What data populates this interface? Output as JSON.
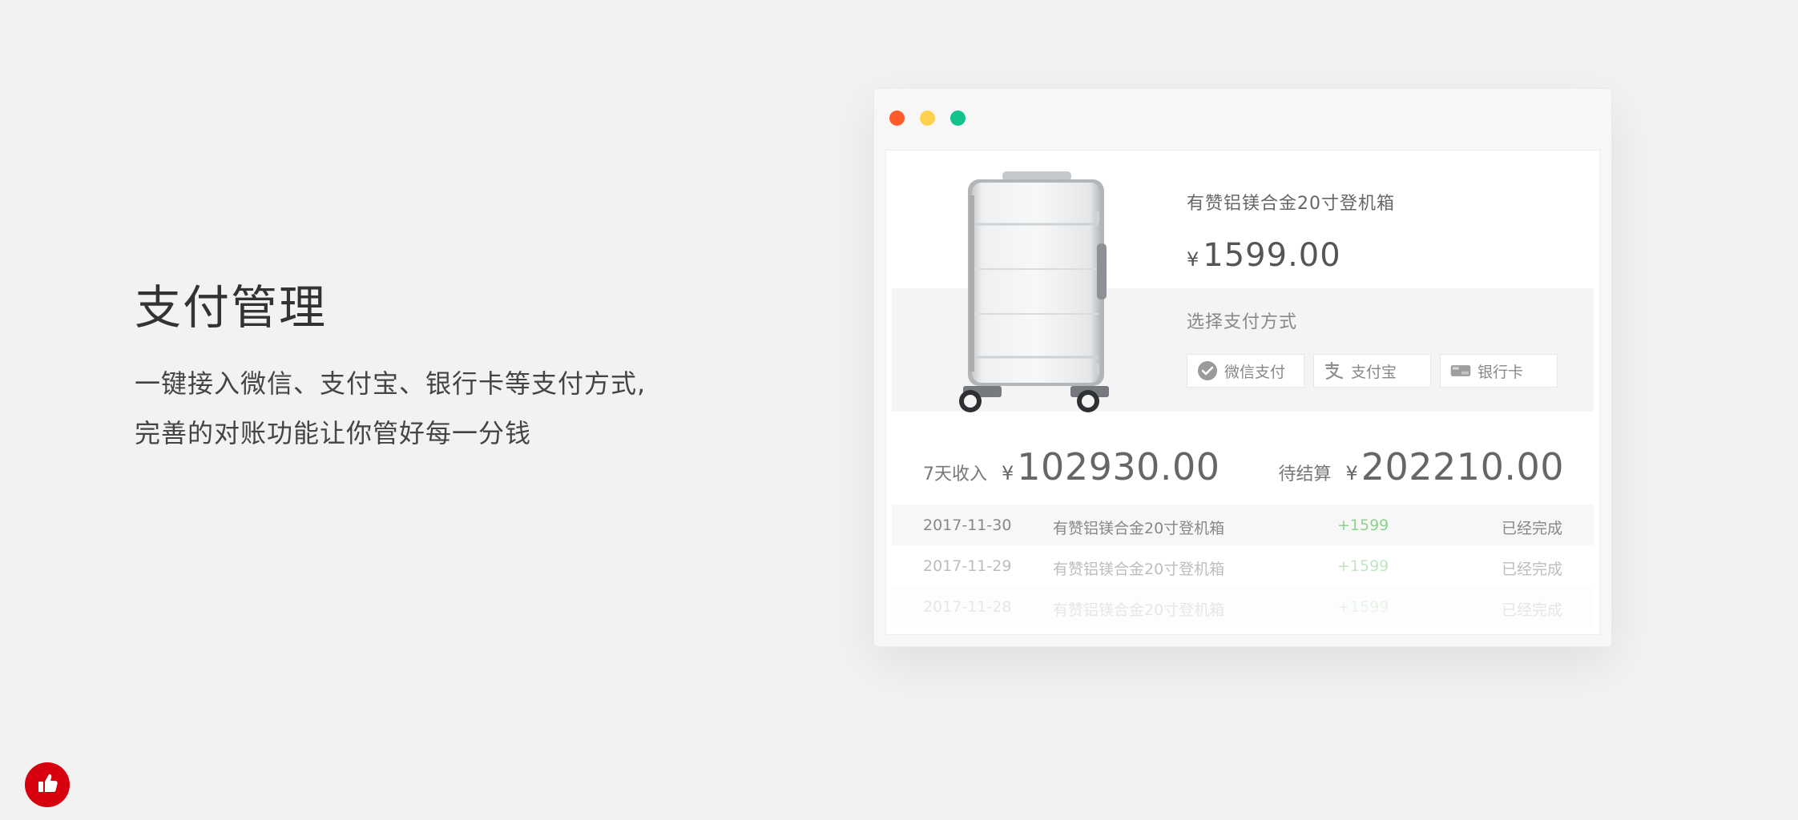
{
  "hero": {
    "title": "支付管理",
    "desc_line1": "一键接入微信、支付宝、银行卡等支付方式,",
    "desc_line2": "完善的对账功能让你管好每一分钱"
  },
  "window": {
    "dot_colors": [
      "#ff5a2c",
      "#ffd24d",
      "#12c38e"
    ],
    "product": {
      "title": "有赞铝镁合金20寸登机箱",
      "currency": "¥",
      "price": "1599.00",
      "image_icon": "suitcase-icon"
    },
    "payment": {
      "label": "选择支付方式",
      "options": [
        {
          "label": "微信支付",
          "icon": "wechat-pay-icon"
        },
        {
          "label": "支付宝",
          "icon": "alipay-icon"
        },
        {
          "label": "银行卡",
          "icon": "unionpay-card-icon"
        }
      ]
    },
    "stats": {
      "income_label": "7天收入",
      "income_currency": "¥",
      "income_value": "102930.00",
      "pending_label": "待结算",
      "pending_currency": "¥",
      "pending_value": "202210.00"
    },
    "transactions": [
      {
        "date": "2017-11-30",
        "item": "有赞铝镁合金20寸登机箱",
        "amount": "+1599",
        "status": "已经完成"
      },
      {
        "date": "2017-11-29",
        "item": "有赞铝镁合金20寸登机箱",
        "amount": "+1599",
        "status": "已经完成"
      },
      {
        "date": "2017-11-28",
        "item": "有赞铝镁合金20寸登机箱",
        "amount": "+1599",
        "status": "已经完成"
      }
    ]
  },
  "badge": {
    "icon": "thumbs-up-icon",
    "color": "#d7000f"
  }
}
